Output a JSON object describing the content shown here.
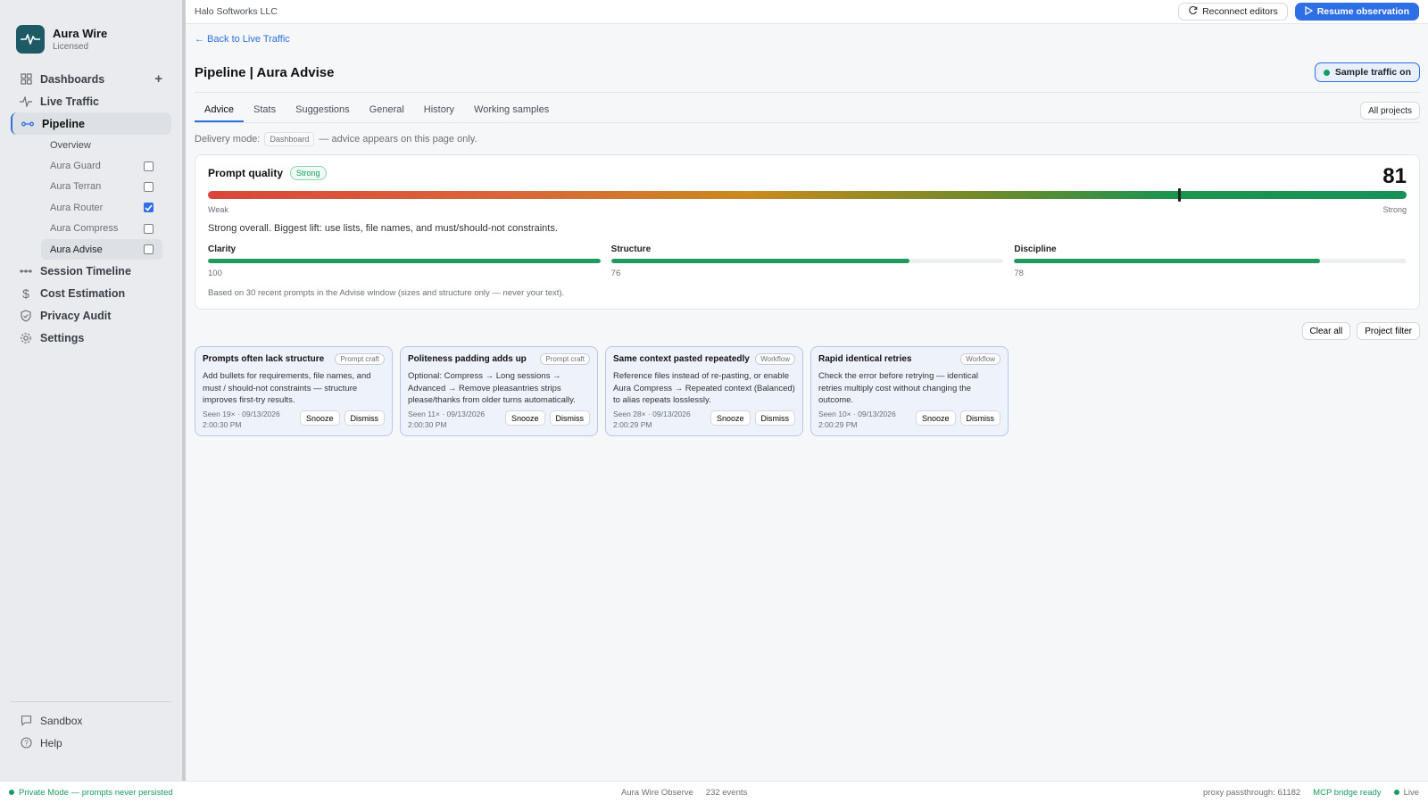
{
  "app": {
    "name": "Aura Wire",
    "license": "Licensed",
    "org": "Halo Softworks LLC"
  },
  "topbar": {
    "reconnect_label": "Reconnect editors",
    "resume_label": "Resume observation"
  },
  "sidebar": {
    "items": [
      {
        "label": "Dashboards",
        "icon": "grid-icon"
      },
      {
        "label": "Live Traffic",
        "icon": "activity-icon"
      },
      {
        "label": "Pipeline",
        "icon": "pipeline-icon"
      },
      {
        "label": "Session Timeline",
        "icon": "timeline-icon"
      },
      {
        "label": "Cost Estimation",
        "icon": "dollar-icon"
      },
      {
        "label": "Privacy Audit",
        "icon": "shield-icon"
      },
      {
        "label": "Settings",
        "icon": "gear-icon"
      }
    ],
    "pipeline_children": [
      {
        "label": "Overview"
      },
      {
        "label": "Aura Guard",
        "checked": false
      },
      {
        "label": "Aura Terran",
        "checked": false
      },
      {
        "label": "Aura Router",
        "checked": true
      },
      {
        "label": "Aura Compress",
        "checked": false
      },
      {
        "label": "Aura Advise",
        "checked": false
      }
    ],
    "bottom": [
      {
        "label": "Sandbox",
        "icon": "chat-icon"
      },
      {
        "label": "Help",
        "icon": "help-icon"
      }
    ]
  },
  "main": {
    "back_link": "← Back to Live Traffic",
    "title": "Pipeline | Aura Advise",
    "sample_toggle": "Sample traffic on",
    "tabs": [
      "Advice",
      "Stats",
      "Suggestions",
      "General",
      "History",
      "Working samples"
    ],
    "active_tab": "Advice",
    "all_projects": "All projects",
    "delivery": {
      "prefix": "Delivery mode:",
      "mode": "Dashboard",
      "suffix": "— advice appears on this page only."
    }
  },
  "quality": {
    "title": "Prompt quality",
    "badge": "Strong",
    "score": "81",
    "score_fraction": 0.81,
    "low_label": "Weak",
    "high_label": "Strong",
    "summary": "Strong overall. Biggest lift: use lists, file names, and must/should-not constraints.",
    "metrics": [
      {
        "name": "Clarity",
        "value": "100",
        "fraction": 1.0
      },
      {
        "name": "Structure",
        "value": "76",
        "fraction": 0.76
      },
      {
        "name": "Discipline",
        "value": "78",
        "fraction": 0.78
      }
    ],
    "footnote": "Based on 30 recent prompts in the Advise window (sizes and structure only — never your text)."
  },
  "filters": {
    "clear_all": "Clear all",
    "project_filter": "Project filter"
  },
  "suggestions": [
    {
      "title": "Prompts often lack structure",
      "tag": "Prompt craft",
      "body": "Add bullets for requirements, file names, and must / should-not constraints — structure improves first-try results.",
      "seen": "Seen 19× · 09/13/2026 2:00:30 PM"
    },
    {
      "title": "Politeness padding adds up",
      "tag": "Prompt craft",
      "body": "Optional: Compress → Long sessions → Advanced → Remove pleasantries strips please/thanks from older turns automatically.",
      "seen": "Seen 11× · 09/13/2026 2:00:30 PM"
    },
    {
      "title": "Same context pasted repeatedly",
      "tag": "Workflow",
      "body": "Reference files instead of re-pasting, or enable Aura Compress → Repeated context (Balanced) to alias repeats losslessly.",
      "seen": "Seen 28× · 09/13/2026 2:00:29 PM"
    },
    {
      "title": "Rapid identical retries",
      "tag": "Workflow",
      "body": "Check the error before retrying — identical retries multiply cost without changing the outcome.",
      "seen": "Seen 10× · 09/13/2026 2:00:29 PM"
    }
  ],
  "suggestion_actions": {
    "snooze": "Snooze",
    "dismiss": "Dismiss"
  },
  "status": {
    "left": "Private Mode — prompts never persisted",
    "center_app": "Aura Wire Observe",
    "center_events": "232 events",
    "proxy": "proxy passthrough: 61182",
    "mcp": "MCP bridge ready",
    "live": "Live"
  },
  "colors": {
    "accent": "#2f6fe6",
    "success": "#1a9b62",
    "brand": "#1d5a66"
  }
}
